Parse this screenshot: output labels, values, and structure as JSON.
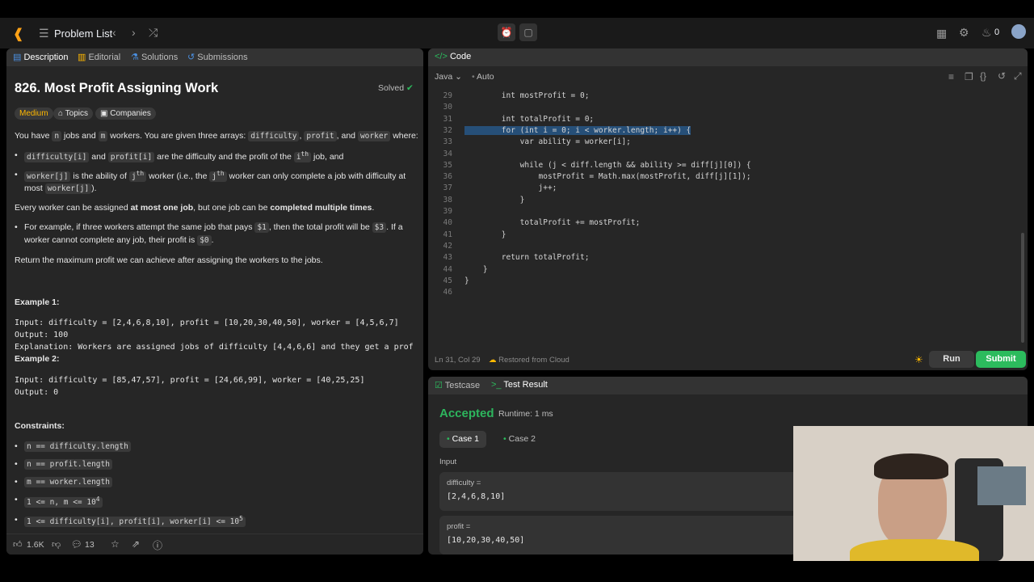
{
  "topbar": {
    "problem_list": "Problem List",
    "streak_count": "0"
  },
  "left_tabs": [
    "Description",
    "Editorial",
    "Solutions",
    "Submissions"
  ],
  "problem": {
    "title": "826. Most Profit Assigning Work",
    "status": "Solved",
    "difficulty": "Medium",
    "topics": "Topics",
    "companies": "Companies",
    "intro_pre": "You have",
    "intro_n": "n",
    "intro_mid1": "jobs and",
    "intro_m": "m",
    "intro_mid2": "workers. You are given three arrays:",
    "intro_a1": "difficulty",
    "intro_a2": "profit",
    "intro_and": ", and",
    "intro_a3": "worker",
    "intro_end": "where:",
    "b1_code1": "difficulty[i]",
    "b1_and": "and",
    "b1_code2": "profit[i]",
    "b1_rest": "are the difficulty and the profit of the",
    "b1_ith": "i",
    "b1_th": "th",
    "b1_end": "job, and",
    "b2_code": "worker[j]",
    "b2_rest": "is the ability of",
    "b2_jth": "j",
    "b2_th": "th",
    "b2_rest2": "worker (i.e., the",
    "b2_jth2": "j",
    "b2_th2": "th",
    "b2_rest3": "worker can only complete a job with difficulty at most",
    "b2_code2": "worker[j]",
    "b2_end": ").",
    "p2_pre": "Every worker can be assigned",
    "p2_bold1": "at most one job",
    "p2_mid": ", but one job can be",
    "p2_bold2": "completed multiple times",
    "p2_end": ".",
    "b3_pre": "For example, if three workers attempt the same job that pays",
    "b3_code1": "$1",
    "b3_mid": ", then the total profit will be",
    "b3_code2": "$3",
    "b3_mid2": ". If a worker cannot complete any job, their profit is",
    "b3_code3": "$0",
    "b3_end": ".",
    "p3": "Return the maximum profit we can achieve after assigning the workers to the jobs.",
    "ex1_title": "Example 1:",
    "ex1_input": "Input: difficulty = [2,4,6,8,10], profit = [10,20,30,40,50], worker = [4,5,6,7]",
    "ex1_output": "Output: 100",
    "ex1_expl": "Explanation: Workers are assigned jobs of difficulty [4,4,6,6] and they get a prof",
    "ex2_title": "Example 2:",
    "ex2_input": "Input: difficulty = [85,47,57], profit = [24,66,99], worker = [40,25,25]",
    "ex2_output": "Output: 0",
    "constraints_title": "Constraints:",
    "c1": "n == difficulty.length",
    "c2": "n == profit.length",
    "c3": "m == worker.length",
    "c4": "1 <= n, m <= 10",
    "c4_sup": "4",
    "c5": "1 <= difficulty[i], profit[i], worker[i] <= 10",
    "c5_sup": "5"
  },
  "footer_left": {
    "likes": "1.6K",
    "comments": "13"
  },
  "code": {
    "tab": "Code",
    "language": "Java",
    "auto": "Auto",
    "status": "Ln 31, Col 29",
    "restored": "Restored from Cloud",
    "run": "Run",
    "submit": "Submit",
    "lines": [
      {
        "n": "29",
        "t": "        int mostProfit = 0;"
      },
      {
        "n": "30",
        "t": ""
      },
      {
        "n": "31",
        "t": "        int totalProfit = 0;"
      },
      {
        "n": "32",
        "t": "        for (int i = 0; i < worker.length; i++) {"
      },
      {
        "n": "33",
        "t": "            var ability = worker[i];"
      },
      {
        "n": "34",
        "t": ""
      },
      {
        "n": "35",
        "t": "            while (j < diff.length && ability >= diff[j][0]) {"
      },
      {
        "n": "36",
        "t": "                mostProfit = Math.max(mostProfit, diff[j][1]);"
      },
      {
        "n": "37",
        "t": "                j++;"
      },
      {
        "n": "38",
        "t": "            }"
      },
      {
        "n": "39",
        "t": ""
      },
      {
        "n": "40",
        "t": "            totalProfit += mostProfit;"
      },
      {
        "n": "41",
        "t": "        }"
      },
      {
        "n": "42",
        "t": ""
      },
      {
        "n": "43",
        "t": "        return totalProfit;"
      },
      {
        "n": "44",
        "t": "    }"
      },
      {
        "n": "45",
        "t": "}"
      },
      {
        "n": "46",
        "t": ""
      }
    ]
  },
  "test": {
    "tab_testcase": "Testcase",
    "tab_result": "Test Result",
    "accepted": "Accepted",
    "runtime": "Runtime: 1 ms",
    "case1": "Case 1",
    "case2": "Case 2",
    "input_label": "Input",
    "var1_name": "difficulty =",
    "var1_value": "[2,4,6,8,10]",
    "var2_name": "profit =",
    "var2_value": "[10,20,30,40,50]"
  },
  "colors": {
    "accent_green": "#2cbb5d",
    "medium_yellow": "#ffb800",
    "accepted_green": "#2db55d"
  }
}
